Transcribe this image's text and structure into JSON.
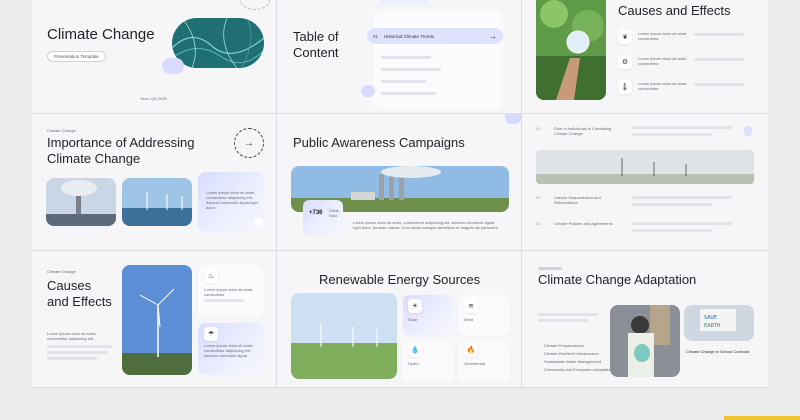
{
  "slides": {
    "s1": {
      "title": "Climate Change",
      "subtitle": "Presentation Template",
      "year": "Year / Q4 2025"
    },
    "s2": {
      "title_line1": "Table of",
      "title_line2": "Content",
      "toc_number": "01",
      "toc_item": "Historical Climate Trends",
      "arrow": "→"
    },
    "s3": {
      "title": "Causes and Effects",
      "b1": "Lorem ipsum dolor sit amet, consectetur",
      "b2": "Lorem ipsum dolor sit amet, consectetur",
      "b3": "Lorem ipsum dolor sit amet, consectetur"
    },
    "s4": {
      "kicker": "Climate Change",
      "title_line1": "Importance of Addressing",
      "title_line2": "Climate Change",
      "arrow": "→",
      "card_text": "Lorem ipsum dolor sit amet, consectetur adipiscing elit, Aenean commodo ligula eget dolor."
    },
    "s5": {
      "title": "Public Awareness Campaigns",
      "stat": "+736",
      "stat_label": "Global Voice",
      "body": "Lorem ipsum dolor sit amet, consectetur adipiscing elit. Aenean commodo ligula eget dolor. Aenean massa. Cum sociis natoque penatibus et magnis dis parturient"
    },
    "s6": {
      "r1_num": "01",
      "r1_text": "Role of Individuals in Combating Climate Change",
      "r2_num": "02",
      "r2_text": "Carbon Sequestration and Reforestation",
      "r3_num": "03",
      "r3_text": "Climate Policies and Agreements"
    },
    "s7": {
      "kicker": "Climate Change",
      "title_line1": "Causes",
      "title_line2": "and Effects",
      "body": "Lorem ipsum dolor sit amet, consectetur adipiscing elit.",
      "c1": "Lorem ipsum dolor sit amet, consectetur",
      "c2": "Lorem ipsum dolor sit amet, consectetur adipiscing elit, Aenean commodo ligula"
    },
    "s8": {
      "title": "Renewable Energy Sources",
      "solar": "Solar",
      "wind": "Wind",
      "hydro": "Hydro",
      "geo": "Geothermal"
    },
    "s9": {
      "title": "Climate Change Adaptation",
      "i1": "Climate Preparedness",
      "i2": "Climate-Resilient Infrastructure",
      "i3": "Sustainable Water Management",
      "i4": "Community and Ecosystem Adaptation",
      "caption": "Climate Change in School Curricula"
    }
  },
  "colors": {
    "accent": "#5a63e8",
    "lavender": "#dfe2ff",
    "background": "#f6f6f8",
    "bar": "#f2c230"
  }
}
